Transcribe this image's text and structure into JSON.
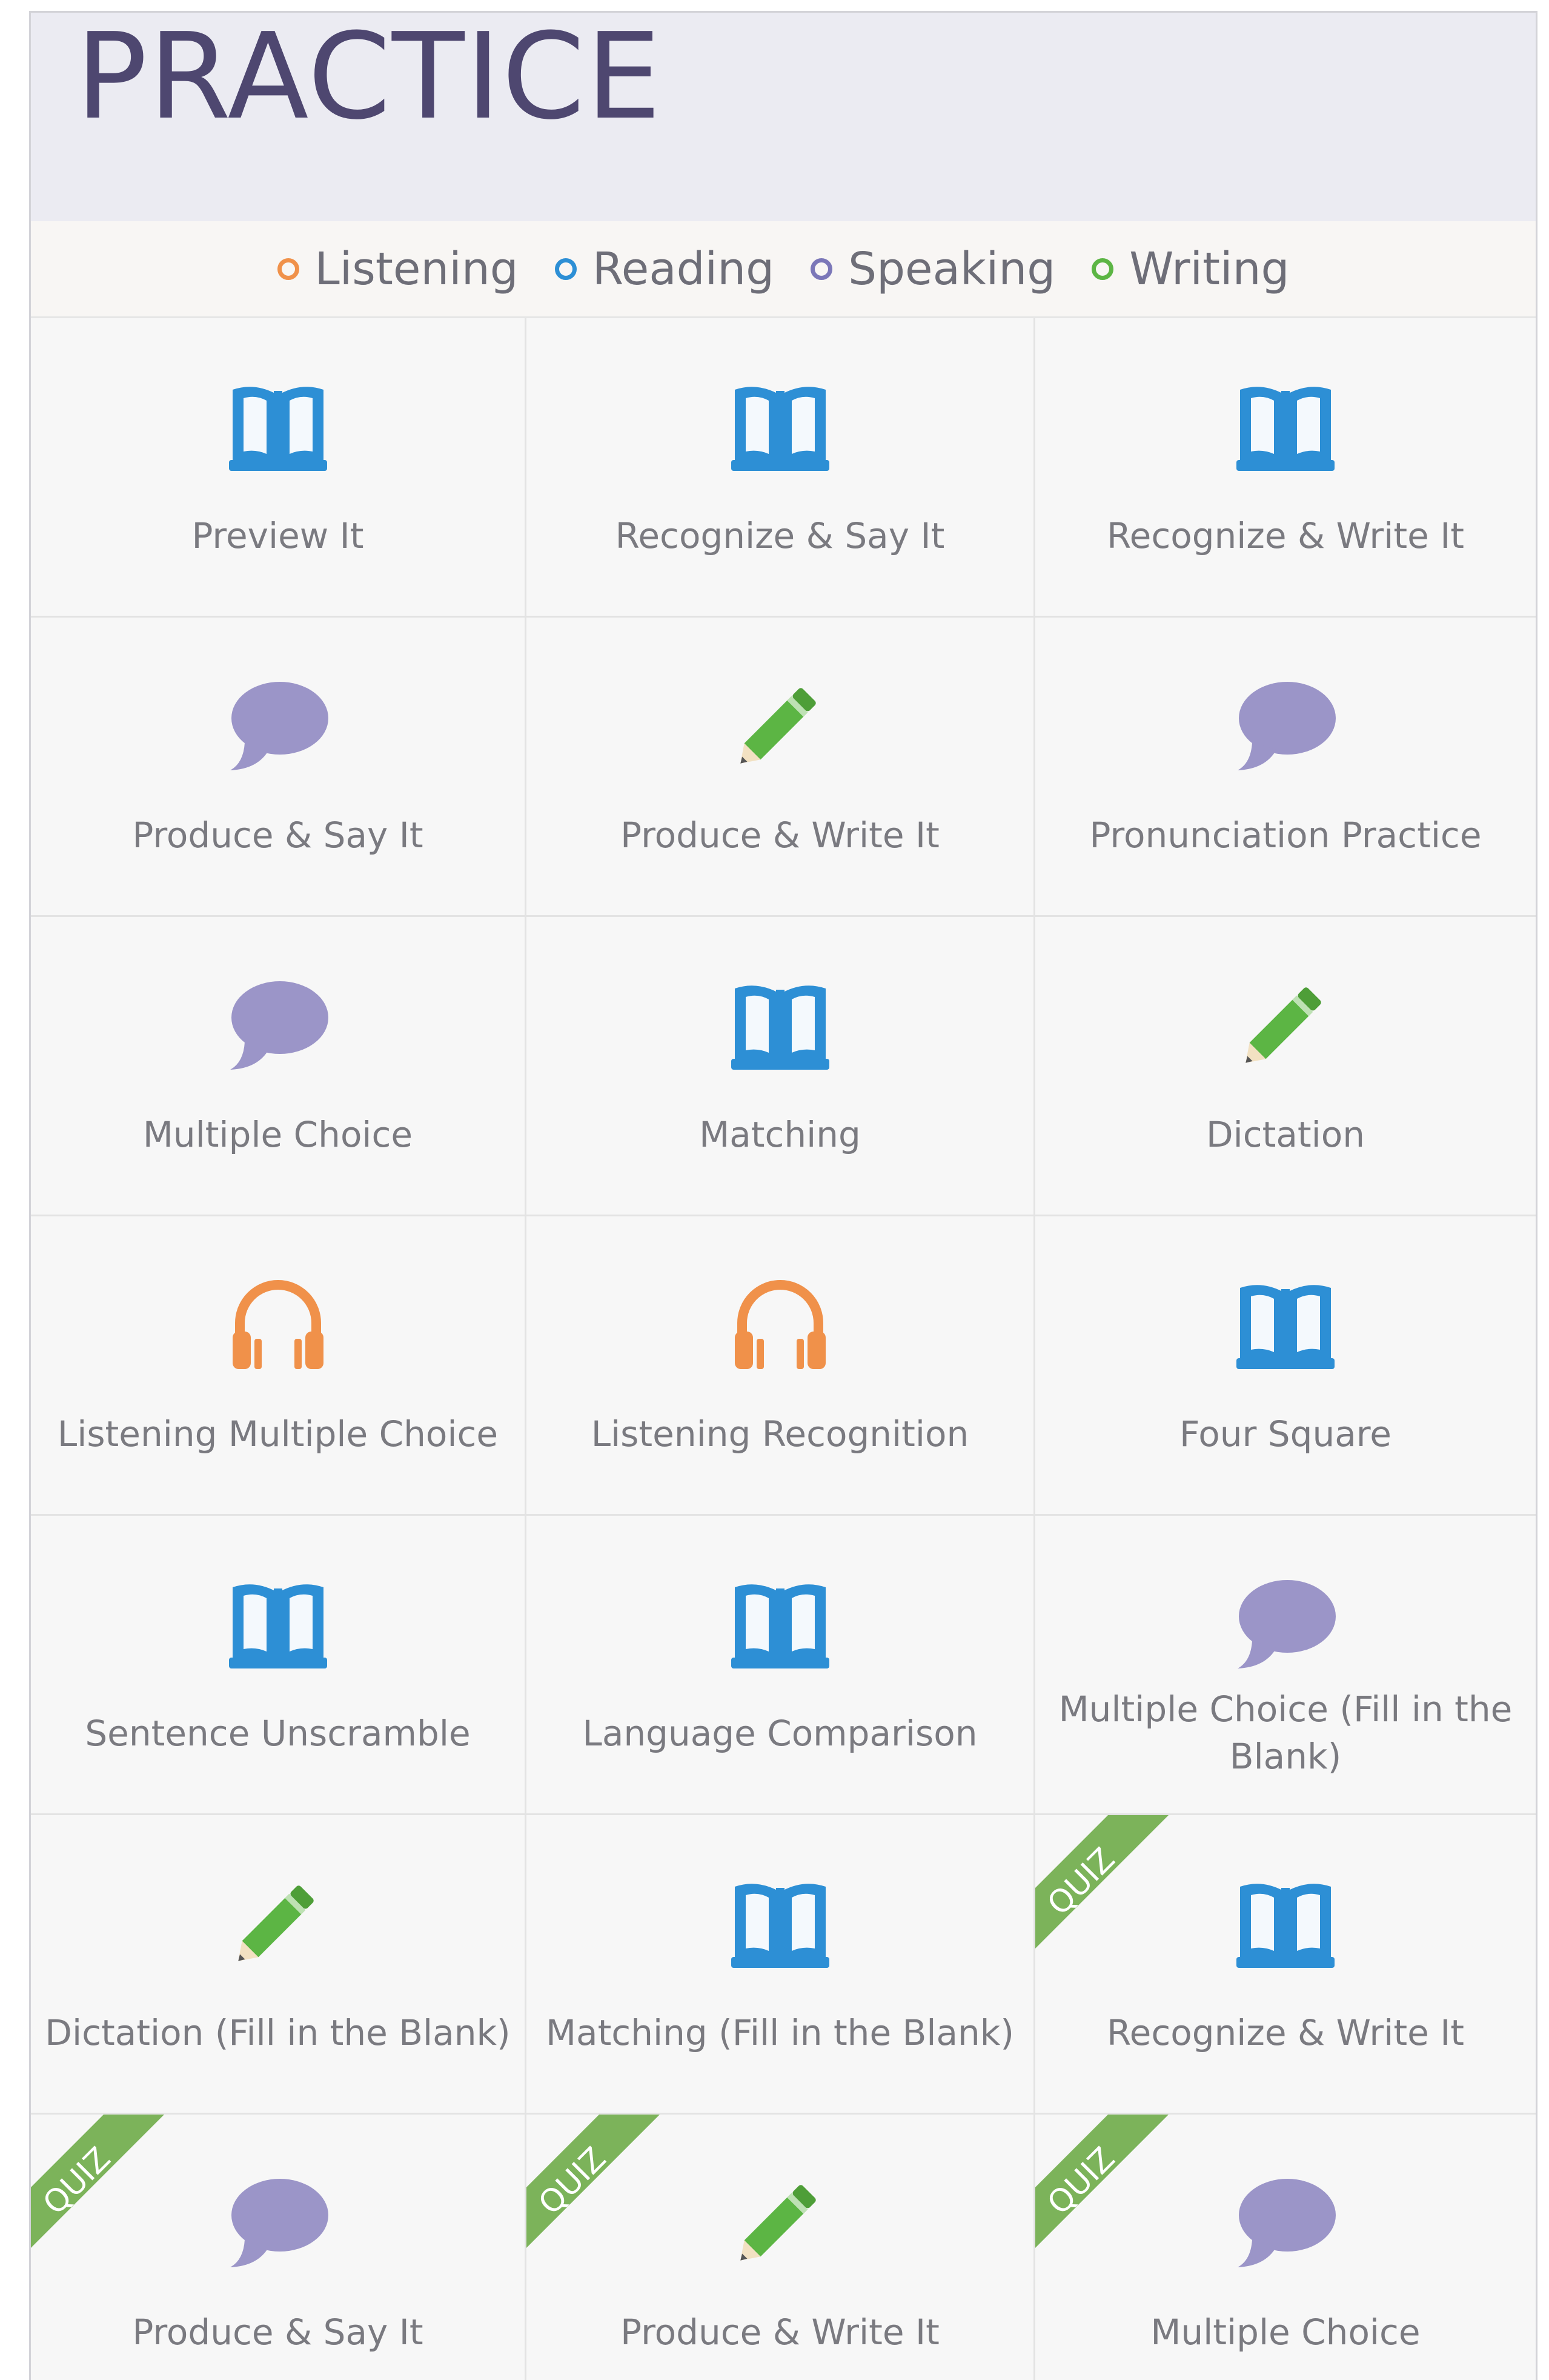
{
  "page_title": "PRACTICE",
  "legend": [
    {
      "label": "Listening",
      "color": "#f0914a"
    },
    {
      "label": "Reading",
      "color": "#2d8fd5"
    },
    {
      "label": "Speaking",
      "color": "#7b77b8"
    },
    {
      "label": "Writing",
      "color": "#5cb544"
    }
  ],
  "colors": {
    "reading": "#2d8fd5",
    "speaking": "#9b95c8",
    "writing": "#5cb544",
    "listening": "#f0914a",
    "quiz_ribbon": "#7cb35a"
  },
  "quiz_label": "QUIZ",
  "activities": [
    {
      "label": "Preview It",
      "icon": "book-icon",
      "quiz": false
    },
    {
      "label": "Recognize & Say It",
      "icon": "book-icon",
      "quiz": false
    },
    {
      "label": "Recognize & Write It",
      "icon": "book-icon",
      "quiz": false
    },
    {
      "label": "Produce & Say It",
      "icon": "speech-bubble-icon",
      "quiz": false
    },
    {
      "label": "Produce & Write It",
      "icon": "pencil-icon",
      "quiz": false
    },
    {
      "label": "Pronunciation Practice",
      "icon": "speech-bubble-icon",
      "quiz": false
    },
    {
      "label": "Multiple Choice",
      "icon": "speech-bubble-icon",
      "quiz": false
    },
    {
      "label": "Matching",
      "icon": "book-icon",
      "quiz": false
    },
    {
      "label": "Dictation",
      "icon": "pencil-icon",
      "quiz": false
    },
    {
      "label": "Listening Multiple Choice",
      "icon": "headphones-icon",
      "quiz": false
    },
    {
      "label": "Listening Recognition",
      "icon": "headphones-icon",
      "quiz": false
    },
    {
      "label": "Four Square",
      "icon": "book-icon",
      "quiz": false
    },
    {
      "label": "Sentence Unscramble",
      "icon": "book-icon",
      "quiz": false
    },
    {
      "label": "Language Comparison",
      "icon": "book-icon",
      "quiz": false
    },
    {
      "label": "Multiple Choice (Fill in the Blank)",
      "icon": "speech-bubble-icon",
      "quiz": false
    },
    {
      "label": "Dictation (Fill in the Blank)",
      "icon": "pencil-icon",
      "quiz": false
    },
    {
      "label": "Matching (Fill in the Blank)",
      "icon": "book-icon",
      "quiz": false
    },
    {
      "label": "Recognize & Write It",
      "icon": "book-icon",
      "quiz": true
    },
    {
      "label": "Produce & Say It",
      "icon": "speech-bubble-icon",
      "quiz": true
    },
    {
      "label": "Produce & Write It",
      "icon": "pencil-icon",
      "quiz": true
    },
    {
      "label": "Multiple Choice",
      "icon": "speech-bubble-icon",
      "quiz": true
    }
  ]
}
